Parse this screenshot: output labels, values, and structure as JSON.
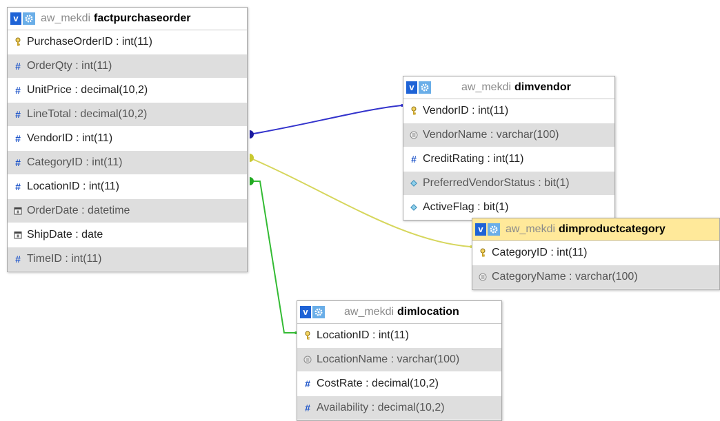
{
  "separator": " : ",
  "tables": {
    "fact": {
      "db": "aw_mekdi",
      "name": "factpurchaseorder",
      "columns": [
        {
          "name": "PurchaseOrderID",
          "type": "int(11)",
          "icon": "key-icon"
        },
        {
          "name": "OrderQty",
          "type": "int(11)",
          "icon": "hash-icon"
        },
        {
          "name": "UnitPrice",
          "type": "decimal(10,2)",
          "icon": "hash-icon"
        },
        {
          "name": "LineTotal",
          "type": "decimal(10,2)",
          "icon": "hash-icon"
        },
        {
          "name": "VendorID",
          "type": "int(11)",
          "icon": "hash-icon"
        },
        {
          "name": "CategoryID",
          "type": "int(11)",
          "icon": "hash-icon"
        },
        {
          "name": "LocationID",
          "type": "int(11)",
          "icon": "hash-icon"
        },
        {
          "name": "OrderDate",
          "type": "datetime",
          "icon": "calendar-icon"
        },
        {
          "name": "ShipDate",
          "type": "date",
          "icon": "calendar-icon"
        },
        {
          "name": "TimeID",
          "type": "int(11)",
          "icon": "hash-icon"
        }
      ]
    },
    "vendor": {
      "db": "aw_mekdi",
      "name": "dimvendor",
      "columns": [
        {
          "name": "VendorID",
          "type": "int(11)",
          "icon": "key-icon"
        },
        {
          "name": "VendorName",
          "type": "varchar(100)",
          "icon": "text-icon"
        },
        {
          "name": "CreditRating",
          "type": "int(11)",
          "icon": "hash-icon"
        },
        {
          "name": "PreferredVendorStatus",
          "type": "bit(1)",
          "icon": "diamond-icon"
        },
        {
          "name": "ActiveFlag",
          "type": "bit(1)",
          "icon": "diamond-icon"
        }
      ]
    },
    "category": {
      "db": "aw_mekdi",
      "name": "dimproductcategory",
      "columns": [
        {
          "name": "CategoryID",
          "type": "int(11)",
          "icon": "key-icon"
        },
        {
          "name": "CategoryName",
          "type": "varchar(100)",
          "icon": "text-icon"
        }
      ]
    },
    "location": {
      "db": "aw_mekdi",
      "name": "dimlocation",
      "columns": [
        {
          "name": "LocationID",
          "type": "int(11)",
          "icon": "key-icon"
        },
        {
          "name": "LocationName",
          "type": "varchar(100)",
          "icon": "text-icon"
        },
        {
          "name": "CostRate",
          "type": "decimal(10,2)",
          "icon": "hash-icon"
        },
        {
          "name": "Availability",
          "type": "decimal(10,2)",
          "icon": "hash-icon"
        }
      ]
    }
  },
  "relations": [
    {
      "from": "factpurchaseorder.VendorID",
      "to": "dimvendor.VendorID",
      "color": "#3333cc"
    },
    {
      "from": "factpurchaseorder.CategoryID",
      "to": "dimproductcategory.CategoryID",
      "color": "#d6d65c"
    },
    {
      "from": "factpurchaseorder.LocationID",
      "to": "dimlocation.LocationID",
      "color": "#33bb33"
    }
  ],
  "colors": {
    "header_active": "#ffe99a",
    "button_blue": "#1e63d6",
    "gear_blue": "#6aaee8",
    "row_alt": "#dedede"
  }
}
